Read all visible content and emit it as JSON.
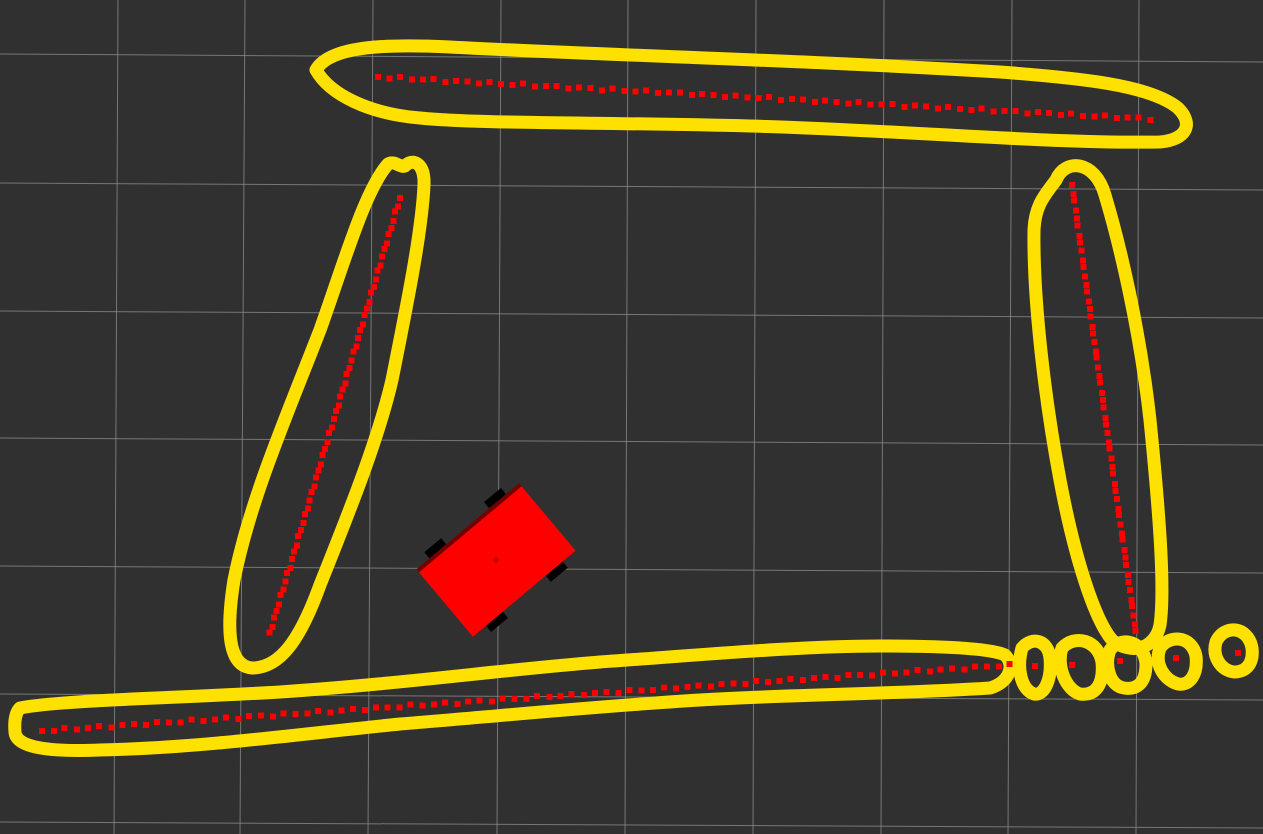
{
  "viewport": {
    "background": "#303030",
    "grid_color": "#8e8e8e"
  },
  "robot": {
    "body_color": "#ff0000",
    "wheel_color": "#000000",
    "heading_deg": -40
  },
  "laser_scan": {
    "point_color": "#ff0000"
  },
  "clusters": {
    "outline_color": "#ffe100",
    "count": 9
  }
}
